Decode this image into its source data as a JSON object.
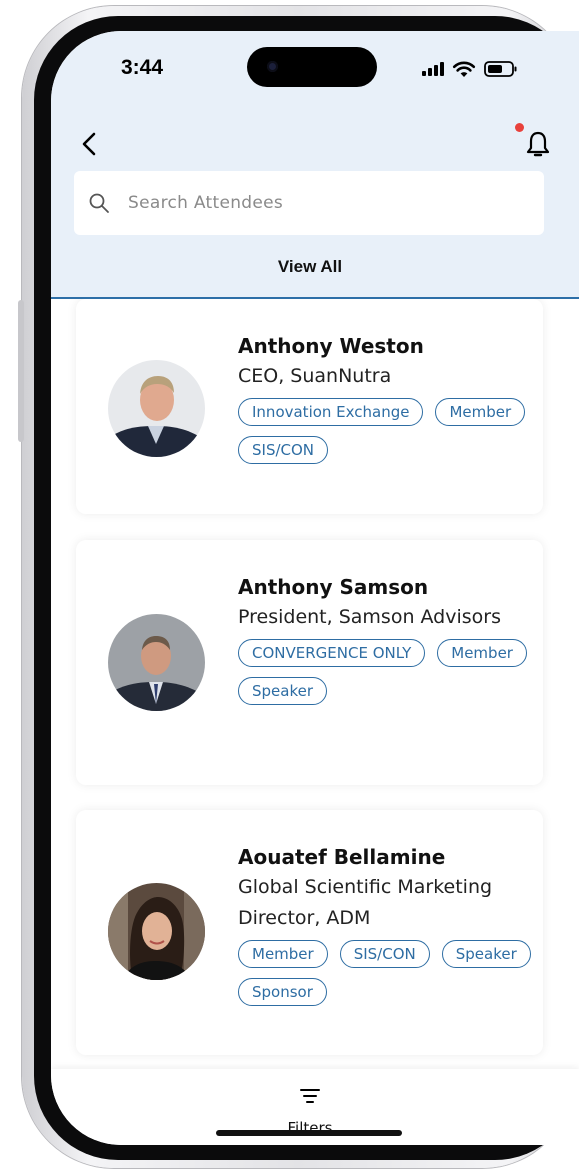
{
  "status_bar": {
    "time": "3:44",
    "icons": [
      "cellular-signal-icon",
      "wifi-icon",
      "battery-icon"
    ]
  },
  "header": {
    "back_icon": "chevron-left-icon",
    "bell_icon": "bell-icon",
    "notification_dot_color": "#e8413c"
  },
  "search": {
    "placeholder": "Search Attendees",
    "value": ""
  },
  "view_all_label": "View All",
  "attendees": [
    {
      "name": "Anthony Weston",
      "title": "CEO, SuanNutra",
      "tags": [
        "Innovation Exchange",
        "Member",
        "SIS/CON"
      ]
    },
    {
      "name": "Anthony Samson",
      "title": "President, Samson Advisors",
      "tags": [
        "CONVERGENCE ONLY",
        "Member",
        "Speaker"
      ]
    },
    {
      "name": "Aouatef Bellamine",
      "title": "Global Scientific Marketing Director, ADM",
      "tags": [
        "Member",
        "SIS/CON",
        "Speaker",
        "Sponsor"
      ]
    }
  ],
  "bottom_bar": {
    "filter_icon": "filter-icon",
    "filters_label": "Filters"
  },
  "colors": {
    "header_bg": "#e8f0f9",
    "accent": "#2e6da3",
    "tag_border": "#2e6da3"
  }
}
